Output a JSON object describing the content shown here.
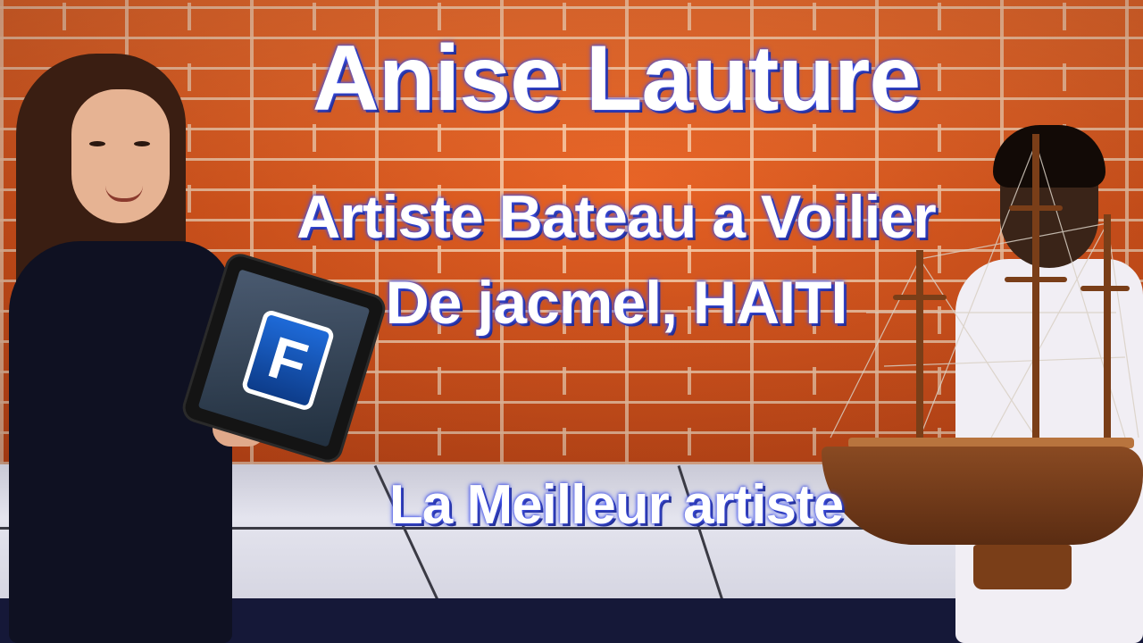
{
  "title": {
    "line1": "Anise Lauture",
    "line2": "Artiste Bateau a Voilier",
    "line3": "De jacmel, HAITI",
    "tagline": "La Meilleur artiste"
  },
  "tablet": {
    "logo_letter": "F"
  },
  "colors": {
    "text": "#ffffff",
    "text_glow": "#4a5cff",
    "wall": "#d4501a",
    "floor": "#d6d6e2",
    "base": "#151838"
  }
}
